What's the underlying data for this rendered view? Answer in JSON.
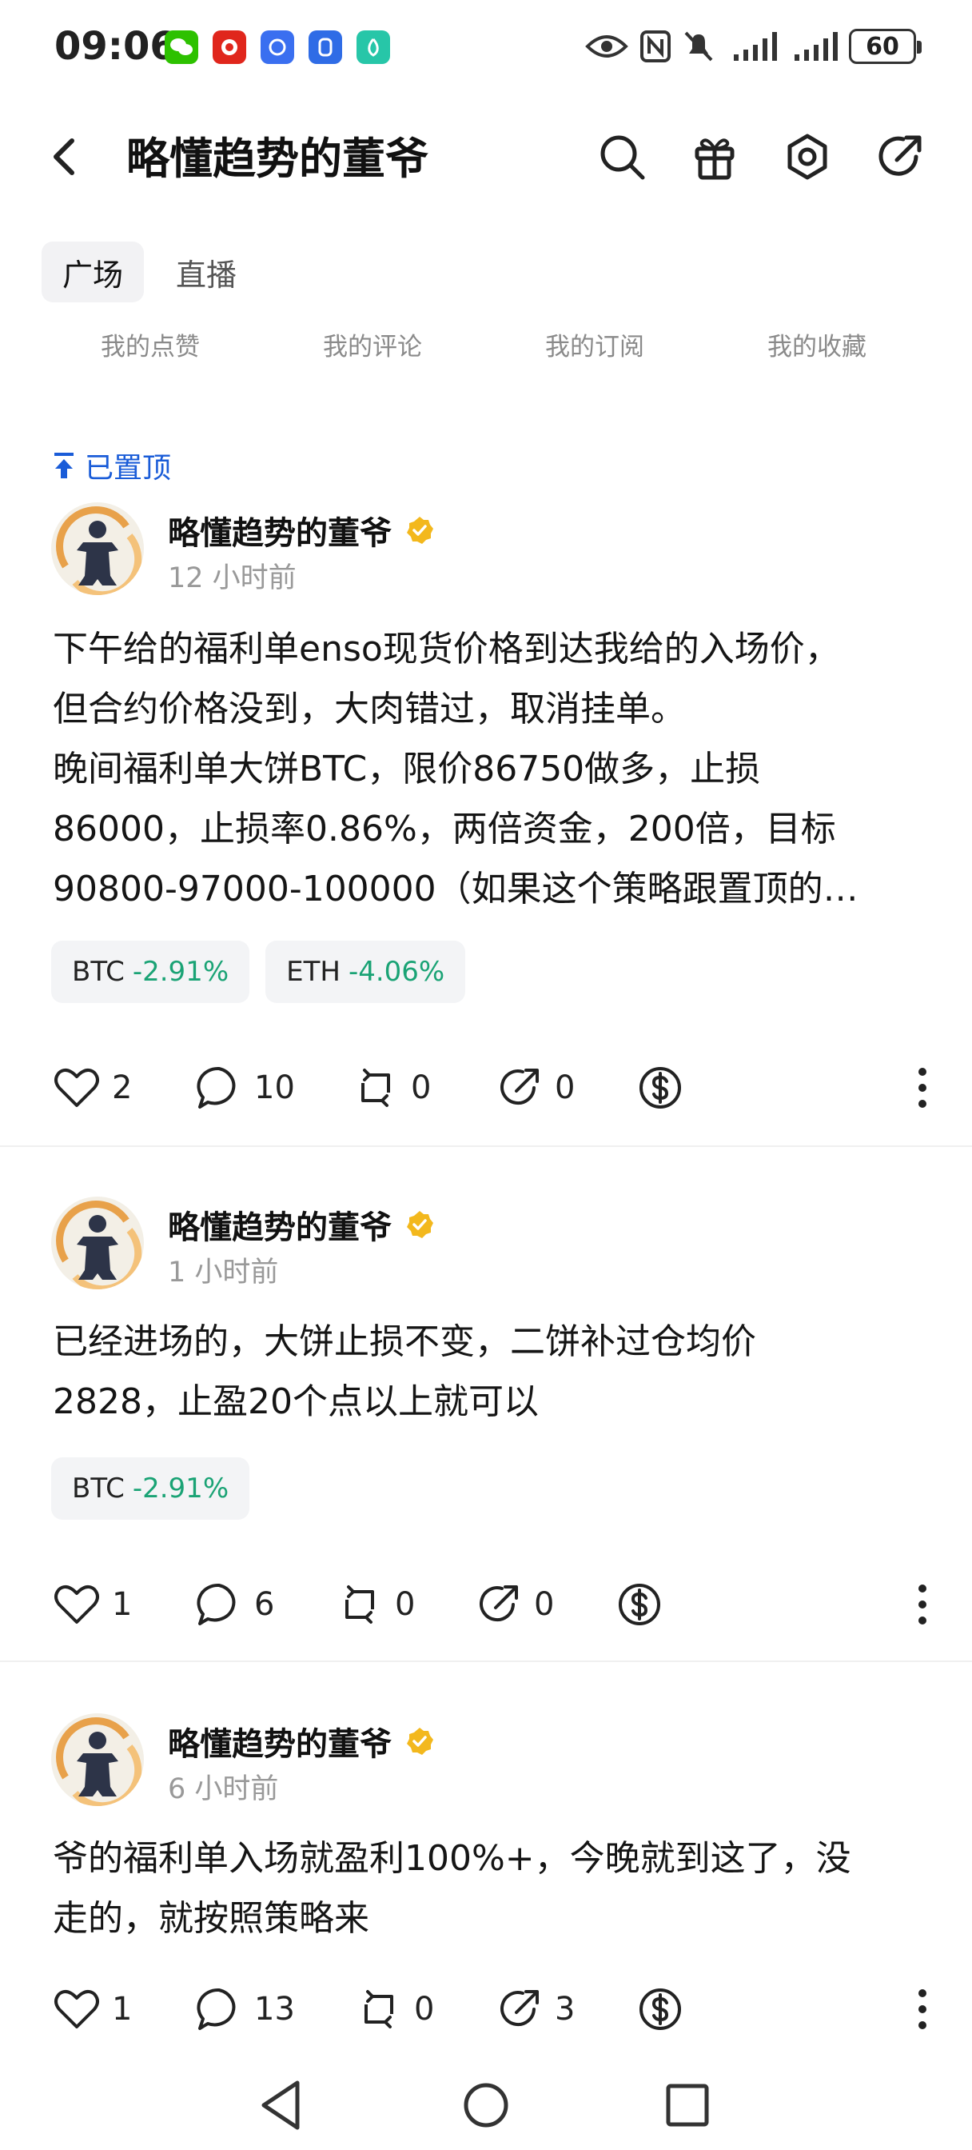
{
  "status_bar": {
    "time": "09:06",
    "battery": "60",
    "notification_icons": [
      "wechat-icon",
      "pinduoduo-icon",
      "app-blue-icon",
      "app-lock-icon",
      "app-teal-icon"
    ],
    "right_icons": [
      "eye-icon",
      "nfc-icon",
      "mute-icon",
      "signal-icon",
      "signal-icon",
      "battery-icon"
    ]
  },
  "header": {
    "title": "略懂趋势的董爷",
    "icons": [
      "back-icon",
      "search-icon",
      "gift-icon",
      "settings-icon",
      "share-icon"
    ]
  },
  "tabs": [
    {
      "label": "广场",
      "active": true
    },
    {
      "label": "直播",
      "active": false
    }
  ],
  "subtabs": [
    "我的点赞",
    "我的评论",
    "我的订阅",
    "我的收藏"
  ],
  "pinned_label": "已置顶",
  "posts": [
    {
      "author": "略懂趋势的董爷",
      "time": "12 小时前",
      "content_lines": [
        "下午给的福利单enso现货价格到达我给的入场价，",
        "但合约价格没到，大肉错过，取消挂单。",
        "晚间福利单大饼BTC，限价86750做多，止损",
        "86000，止损率0.86%，两倍资金，200倍，目标",
        "90800-97000-100000（如果这个策略跟置顶的…"
      ],
      "tags": [
        {
          "symbol": "BTC",
          "change": "-2.91%"
        },
        {
          "symbol": "ETH",
          "change": "-4.06%"
        }
      ],
      "likes": "2",
      "comments": "10",
      "reposts": "0",
      "shares": "0"
    },
    {
      "author": "略懂趋势的董爷",
      "time": "1 小时前",
      "content_lines": [
        "已经进场的，大饼止损不变，二饼补过仓均价",
        "2828，止盈20个点以上就可以"
      ],
      "tags": [
        {
          "symbol": "BTC",
          "change": "-2.91%"
        }
      ],
      "likes": "1",
      "comments": "6",
      "reposts": "0",
      "shares": "0"
    },
    {
      "author": "略懂趋势的董爷",
      "time": "6 小时前",
      "content_lines": [
        "爷的福利单入场就盈利100%+，今晚就到这了，没",
        "走的，就按照策略来"
      ],
      "tags": [],
      "likes": "1",
      "comments": "13",
      "reposts": "0",
      "shares": "3"
    }
  ],
  "colors": {
    "accent_blue": "#1a5cd8",
    "negative_change_green": "#1aa375",
    "verify_gold": "#f3b81d"
  }
}
